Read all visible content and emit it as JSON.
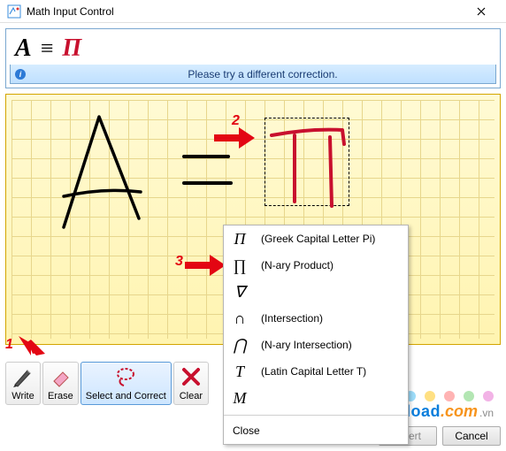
{
  "window": {
    "title": "Math Input Control"
  },
  "formula": {
    "A": "A",
    "eq": "≡",
    "Pi": "Π"
  },
  "status": {
    "message": "Please try a different correction."
  },
  "toolbar": {
    "write": "Write",
    "erase": "Erase",
    "select_correct": "Select and Correct",
    "clear": "Clear"
  },
  "buttons": {
    "insert": "Insert",
    "cancel": "Cancel"
  },
  "menu": {
    "items": [
      {
        "symbol": "Π",
        "label": "(Greek Capital Letter Pi)"
      },
      {
        "symbol": "∏",
        "label": "(N-ary Product)"
      },
      {
        "symbol": "∇",
        "label": ""
      },
      {
        "symbol": "∩",
        "label": "(Intersection)"
      },
      {
        "symbol": "⋂",
        "label": "(N-ary Intersection)"
      },
      {
        "symbol": "T",
        "label": "(Latin Capital Letter T)"
      },
      {
        "symbol": "M",
        "label": ""
      }
    ],
    "close": "Close"
  },
  "annotations": {
    "one": "1",
    "two": "2",
    "three": "3"
  },
  "watermark": {
    "a": "Download",
    "b": ".com",
    "c": ".vn"
  },
  "dots": [
    "#9ddcf9",
    "#ffe082",
    "#ffb3b3",
    "#b3e6b3",
    "#f2b3e6"
  ]
}
